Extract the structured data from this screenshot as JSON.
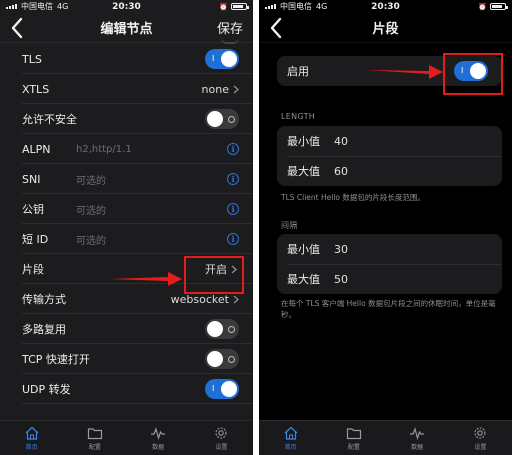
{
  "status": {
    "carrier": "中国电信",
    "network": "4G",
    "time": "20:30"
  },
  "left": {
    "title": "编辑节点",
    "save_label": "保存",
    "rows": [
      {
        "label": "TLS",
        "type": "toggle",
        "on": true
      },
      {
        "label": "XTLS",
        "type": "value",
        "value": "none"
      },
      {
        "label": "允许不安全",
        "type": "toggle",
        "on": false
      },
      {
        "label": "ALPN",
        "type": "input",
        "placeholder": "h2,http/1.1"
      },
      {
        "label": "SNI",
        "type": "input",
        "placeholder": "可选的"
      },
      {
        "label": "公钥",
        "type": "input",
        "placeholder": "可选的"
      },
      {
        "label": "短 ID",
        "type": "input",
        "placeholder": "可选的"
      },
      {
        "label": "片段",
        "type": "value",
        "value": "开启"
      },
      {
        "label": "传输方式",
        "type": "value",
        "value": "websocket"
      },
      {
        "label": "多路复用",
        "type": "toggle",
        "on": false
      },
      {
        "label": "TCP 快速打开",
        "type": "toggle",
        "on": false
      },
      {
        "label": "UDP 转发",
        "type": "toggle",
        "on": true
      }
    ]
  },
  "right": {
    "title": "片段",
    "enable_label": "启用",
    "enable_on": true,
    "length_header": "LENGTH",
    "length_min_label": "最小值",
    "length_min": "40",
    "length_max_label": "最大值",
    "length_max": "60",
    "length_note": "TLS Client Hello 数据包的片段长度范围。",
    "interval_header": "间隔",
    "interval_min_label": "最小值",
    "interval_min": "30",
    "interval_max_label": "最大值",
    "interval_max": "50",
    "interval_note": "在每个 TLS 客户端 Hello 数据包片段之间的休眠时间，单位是毫秒。"
  },
  "tabs": [
    {
      "label": "首页",
      "icon": "home-icon",
      "active": true
    },
    {
      "label": "配置",
      "icon": "folder-icon",
      "active": false
    },
    {
      "label": "数据",
      "icon": "pulse-icon",
      "active": false
    },
    {
      "label": "设置",
      "icon": "gear-icon",
      "active": false
    }
  ],
  "colors": {
    "accent": "#1f6fd6",
    "highlight": "#e51c1c",
    "background": "#1c1c1e"
  }
}
